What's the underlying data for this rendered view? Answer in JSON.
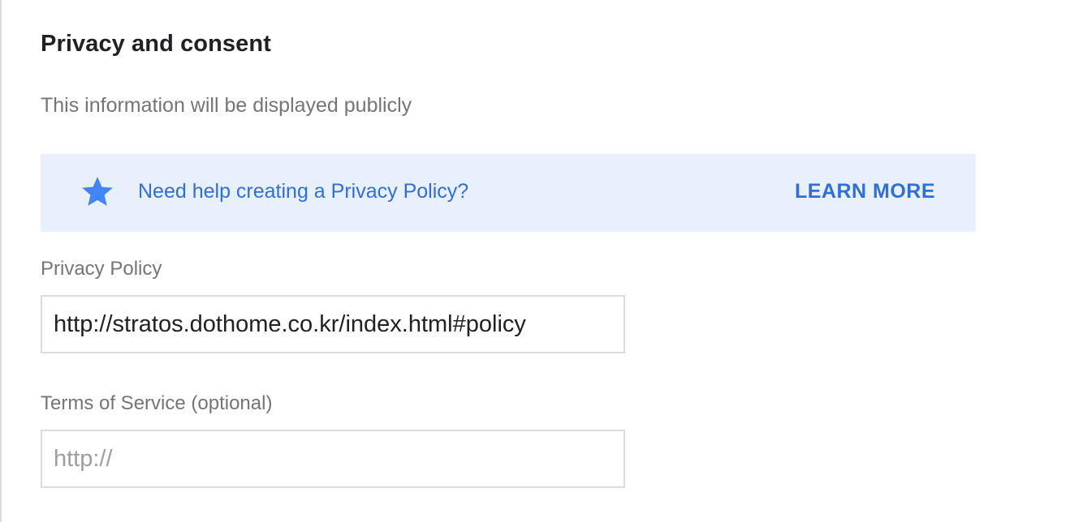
{
  "section": {
    "title": "Privacy and consent",
    "subtitle": "This information will be displayed publicly"
  },
  "help_banner": {
    "icon": "star-icon",
    "text": "Need help creating a Privacy Policy?",
    "action_label": "LEARN MORE",
    "background_color": "#e8f0fd",
    "accent_color": "#2f6fd6"
  },
  "fields": {
    "privacy_policy": {
      "label": "Privacy Policy",
      "value": "http://stratos.dothome.co.kr/index.html#policy",
      "placeholder": ""
    },
    "terms_of_service": {
      "label": "Terms of Service (optional)",
      "value": "",
      "placeholder": "http://"
    }
  }
}
